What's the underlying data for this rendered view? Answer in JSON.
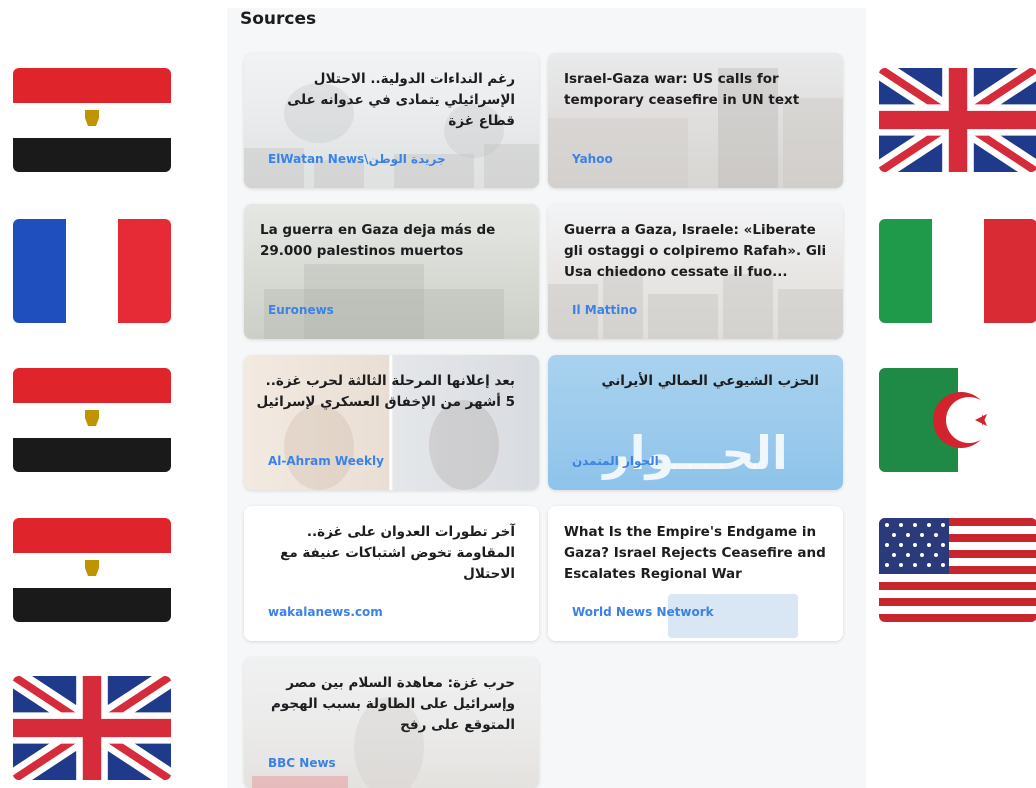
{
  "section": {
    "heading": "Sources"
  },
  "cards": [
    {
      "title": "رغم النداءات الدولية.. الاحتلال الإسرائيلي يتمادى في عدوانه على قطاع غزة",
      "source": "ElWatan News\\جريدة الوطن",
      "dir": "rtl",
      "scene": "smoke"
    },
    {
      "title": "Israel-Gaza war: US calls for temporary ceasefire in UN text",
      "source": "Yahoo",
      "dir": "ltr",
      "scene": "camp"
    },
    {
      "title": "La guerra en Gaza deja más de 29.000 palestinos muertos",
      "source": "Euronews",
      "dir": "ltr",
      "scene": "tank"
    },
    {
      "title": "Guerra a Gaza, Israele: «Liberate gli ostaggi o colpiremo Rafah». Gli Usa chiedono cessate il fuo...",
      "source": "Il Mattino",
      "dir": "ltr",
      "scene": "city"
    },
    {
      "title": "بعد إعلانها المرحلة الثالثة لحرب غزة.. 5 أشهر من الإخفاق العسكري لإسرائيل",
      "source": "Al-Ahram Weekly",
      "dir": "rtl",
      "scene": "faces"
    },
    {
      "title": "الحزب الشيوعي العمالي الأيراني",
      "source": "الحوار المتمدن",
      "dir": "rtl",
      "scene": "hiwar",
      "logo_text": "الحـــوار"
    },
    {
      "title": "آخر تطورات العدوان على غزة.. المقاومة تخوض اشتباكات عنيفة مع الاحتلال",
      "source": "wakalanews.com",
      "dir": "rtl",
      "scene": "plain"
    },
    {
      "title": "What Is the Empire's Endgame in Gaza? Israel Rejects Ceasefire and Escalates Regional War",
      "source": "World News Network",
      "dir": "ltr",
      "scene": "wnn"
    },
    {
      "title": "حرب غزة: معاهدة السلام بين مصر وإسرائيل على الطاولة بسبب الهجوم المتوقع على رفح",
      "source": "BBC News",
      "dir": "rtl",
      "scene": "bbc"
    }
  ],
  "flags": {
    "left": [
      "egypt-flag-icon",
      "france-flag-icon",
      "egypt-flag-icon",
      "egypt-flag-icon",
      "uk-flag-icon"
    ],
    "right": [
      "uk-flag-icon",
      "italy-flag-icon",
      "algeria-flag-icon",
      "usa-flag-icon"
    ]
  },
  "colors": {
    "source_link": "#3b82e6",
    "panel_bg": "#f6f7f8"
  }
}
